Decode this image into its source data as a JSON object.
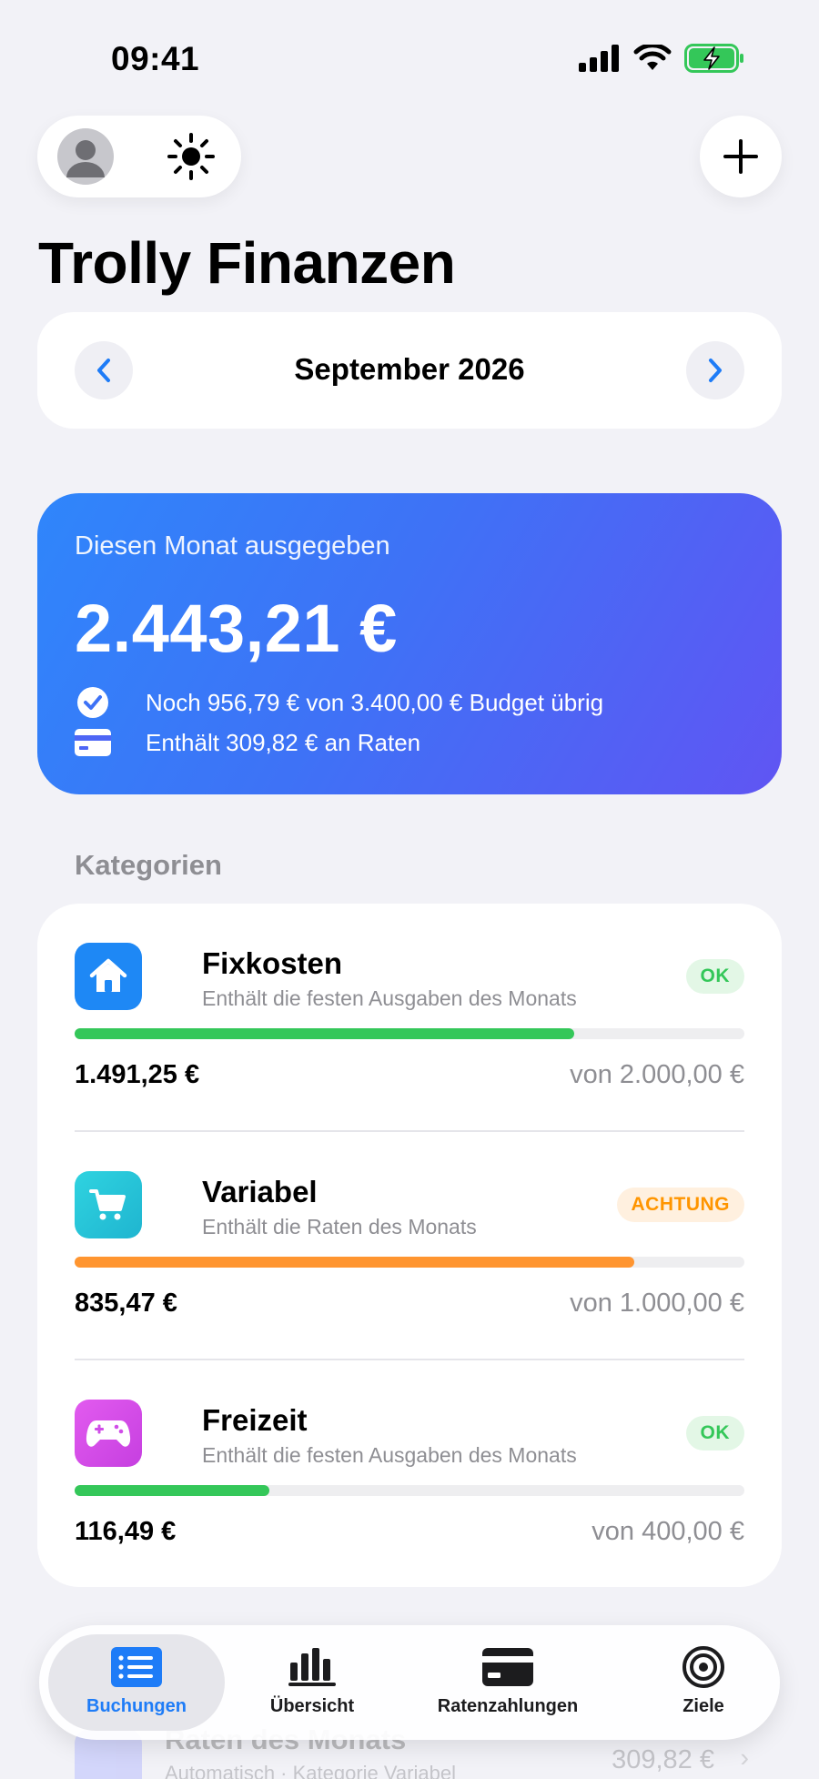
{
  "status_bar": {
    "time": "09:41"
  },
  "header": {
    "title": "Trolly Finanzen"
  },
  "month_selector": {
    "label": "September 2026"
  },
  "summary": {
    "subtitle": "Diesen Monat ausgegeben",
    "amount": "2.443,21 €",
    "budget_line": "Noch 956,79 € von 3.400,00 € Budget übrig",
    "rates_line": "Enthält 309,82 € an Raten"
  },
  "categories": {
    "section_title": "Kategorien",
    "items": [
      {
        "name": "Fixkosten",
        "description": "Enthält die festen Ausgaben des Monats",
        "status": "OK",
        "spent": "1.491,25 €",
        "budget": "von 2.000,00 €",
        "progress": 0.746,
        "color": "#34C759",
        "icon_color": "#1E88F5",
        "icon": "house-icon"
      },
      {
        "name": "Variabel",
        "description": "Enthält die Raten des Monats",
        "status": "ACHTUNG",
        "spent": "835,47 €",
        "budget": "von 1.000,00 €",
        "progress": 0.835,
        "color": "#FF9530",
        "icon_color": "#26C6DA",
        "icon": "cart-icon"
      },
      {
        "name": "Freizeit",
        "description": "Enthält die festen Ausgaben des Monats",
        "status": "OK",
        "spent": "116,49 €",
        "budget": "von 400,00 €",
        "progress": 0.291,
        "color": "#34C759",
        "icon_color": "#D04DE8",
        "icon": "gamepad-icon"
      }
    ]
  },
  "behind_item": {
    "name": "Raten des Monats",
    "description": "Automatisch · Kategorie Variabel",
    "amount": "309,82 €"
  },
  "tab_bar": {
    "tabs": [
      {
        "label": "Buchungen",
        "icon": "list-icon",
        "active": true
      },
      {
        "label": "Übersicht",
        "icon": "chart-icon",
        "active": false
      },
      {
        "label": "Ratenzahlungen",
        "icon": "card-icon",
        "active": false
      },
      {
        "label": "Ziele",
        "icon": "target-icon",
        "active": false
      }
    ]
  },
  "colors": {
    "accent": "#1E7CF7",
    "background": "#F2F2F7",
    "gradient_start": "#2F86FB",
    "gradient_end": "#6055F3"
  }
}
